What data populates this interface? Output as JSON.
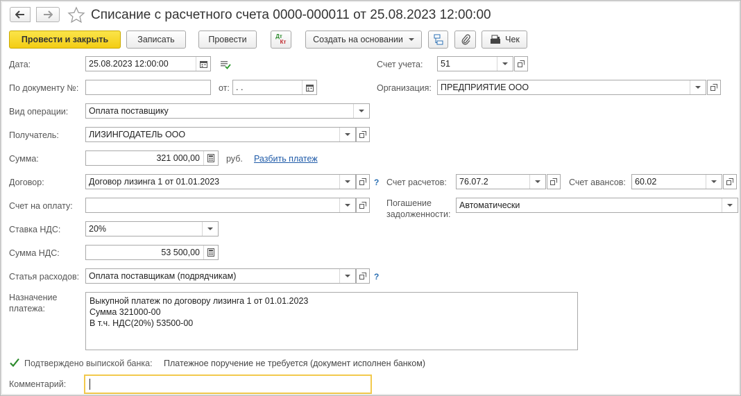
{
  "header": {
    "title": "Списание с расчетного счета 0000-000011 от 25.08.2023 12:00:00"
  },
  "toolbar": {
    "post_close": "Провести и закрыть",
    "save": "Записать",
    "post": "Провести",
    "dtkt_top": "Дт",
    "dtkt_bottom": "Кт",
    "create_based": "Создать на основании",
    "receipt": "Чек"
  },
  "form": {
    "date_label": "Дата:",
    "date_value": "25.08.2023 12:00:00",
    "account_label": "Счет учета:",
    "account_value": "51",
    "doc_num_label": "По документу №:",
    "doc_num_value": "",
    "from_label": "от:",
    "from_value": " .  .",
    "org_label": "Организация:",
    "org_value": "ПРЕДПРИЯТИЕ ООО",
    "operation_label": "Вид операции:",
    "operation_value": "Оплата поставщику",
    "recipient_label": "Получатель:",
    "recipient_value": "ЛИЗИНГОДАТЕЛЬ ООО",
    "sum_label": "Сумма:",
    "sum_value": "321 000,00",
    "currency": "руб.",
    "split_link": "Разбить платеж",
    "contract_label": "Договор:",
    "contract_value": "Договор лизинга 1 от 01.01.2023",
    "settle_label": "Счет расчетов:",
    "settle_value": "76.07.2",
    "advance_label": "Счет авансов:",
    "advance_value": "60.02",
    "invoice_label": "Счет на оплату:",
    "invoice_value": "",
    "repay_label_1": "Погашение",
    "repay_label_2": "задолженности:",
    "repay_value": "Автоматически",
    "vat_rate_label": "Ставка НДС:",
    "vat_rate_value": "20%",
    "vat_sum_label": "Сумма НДС:",
    "vat_sum_value": "53 500,00",
    "expense_label": "Статья расходов:",
    "expense_value": "Оплата поставщикам (подрядчикам)",
    "purpose_label_1": "Назначение",
    "purpose_label_2": "платежа:",
    "purpose_lines": [
      "Выкупной платеж по договору лизинга 1 от 01.01.2023",
      "Сумма 321000-00",
      "В т.ч. НДС(20%) 53500-00"
    ],
    "confirmed_label": "Подтверждено выпиской банка:",
    "confirmed_note": "Платежное поручение не требуется (документ исполнен банком)",
    "comment_label": "Комментарий:",
    "comment_value": ""
  },
  "help_mark": "?"
}
